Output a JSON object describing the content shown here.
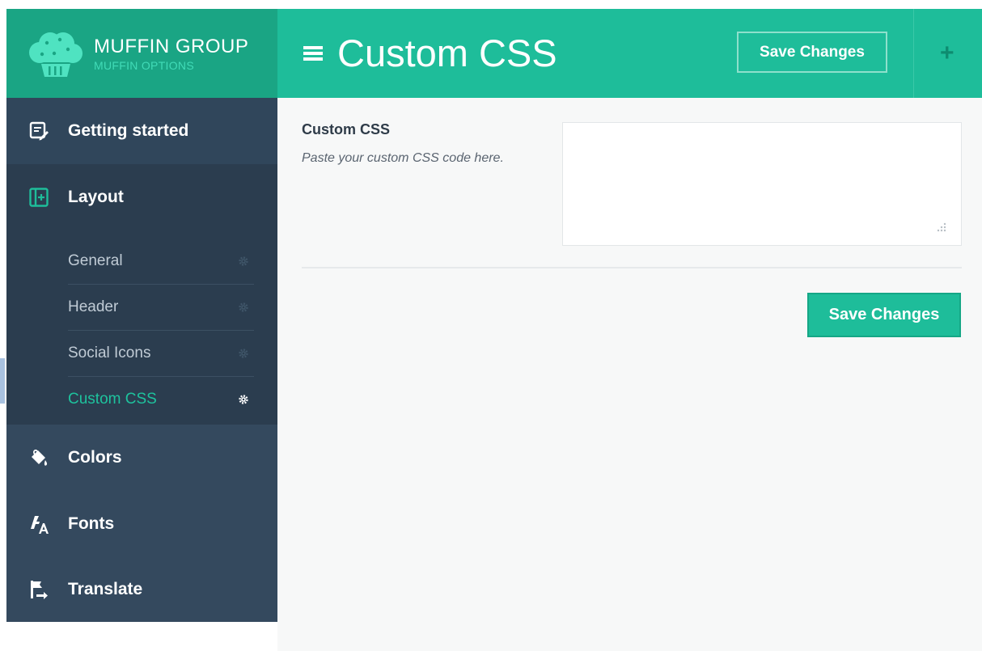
{
  "brand": {
    "title": "MUFFIN GROUP",
    "subtitle": "MUFFIN OPTIONS"
  },
  "header": {
    "menu_icon": "hamburger-icon",
    "title": "Custom CSS",
    "save_label": "Save Changes",
    "plus_icon": "plus-icon"
  },
  "sidebar": {
    "items": [
      {
        "label": "Getting started",
        "icon": "edit-document-icon"
      },
      {
        "label": "Layout",
        "icon": "layout-plus-icon",
        "children": [
          {
            "label": "General",
            "icon": "gear-icon"
          },
          {
            "label": "Header",
            "icon": "gear-icon"
          },
          {
            "label": "Social Icons",
            "icon": "gear-icon"
          },
          {
            "label": "Custom CSS",
            "icon": "gear-icon",
            "active": true
          }
        ]
      },
      {
        "label": "Colors",
        "icon": "paint-bucket-icon"
      },
      {
        "label": "Fonts",
        "icon": "font-icon"
      },
      {
        "label": "Translate",
        "icon": "flag-icon"
      }
    ]
  },
  "main": {
    "field_title": "Custom CSS",
    "field_desc": "Paste your custom CSS code here.",
    "textarea_value": "",
    "save_label": "Save Changes"
  },
  "colors": {
    "accent": "#1ebd9a",
    "accent_dark": "#1aa584",
    "sidebar_bg": "#34495e",
    "active_text": "#1ec29d"
  }
}
